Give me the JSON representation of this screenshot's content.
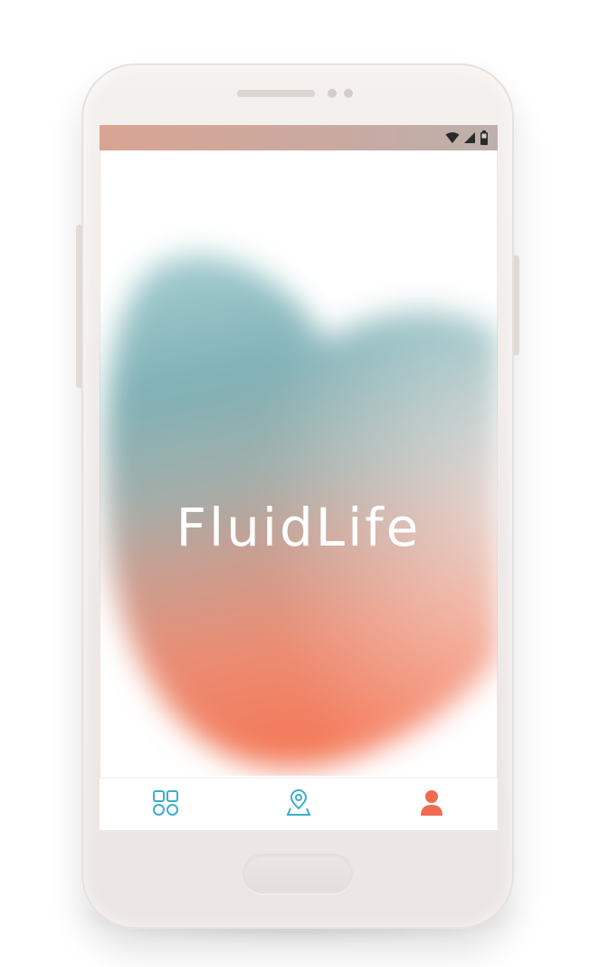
{
  "app": {
    "name": "FluidLife"
  },
  "status_bar": {
    "icons": [
      "wifi-icon",
      "cellular-signal-icon",
      "battery-icon"
    ]
  },
  "bottom_nav": {
    "items": [
      {
        "id": "dashboard",
        "icon": "grid-icon",
        "color": "#3aaecf",
        "active": false
      },
      {
        "id": "location",
        "icon": "map-pin-icon",
        "color": "#3aaecf",
        "active": false
      },
      {
        "id": "profile",
        "icon": "user-icon",
        "color": "#f06a4f",
        "active": true
      }
    ]
  },
  "colors": {
    "teal": "#8fb8bb",
    "coral": "#f07a5c",
    "status_bar": "#d9a493"
  }
}
